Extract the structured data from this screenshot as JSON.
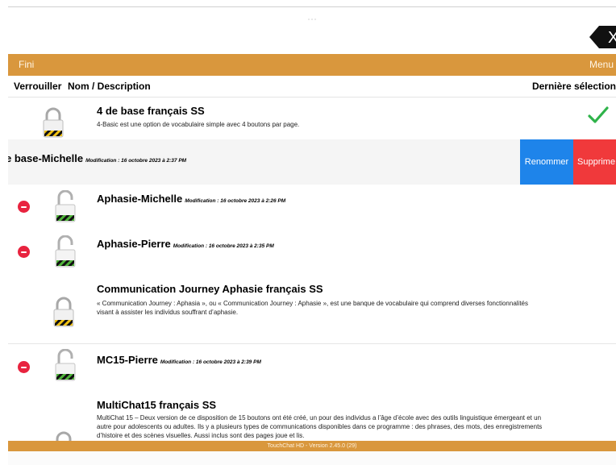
{
  "toolbar": {
    "left_label": "Fini",
    "right_label": "Menu"
  },
  "header": {
    "lock": "Verrouiller",
    "name": "Nom / Description",
    "last": "Dernière sélection"
  },
  "close_label": "X",
  "rows": [
    {
      "title": "4 de base français SS",
      "description": "4-Basic est une option de vocabulaire simple avec 4 boutons par page.",
      "locked": true,
      "selected": true
    },
    {
      "title": "e base-Michelle",
      "modified": "Modification : 16 octobre 2023 à 2:37 PM",
      "actions": {
        "rename": "Renommer",
        "delete": "Supprime"
      }
    },
    {
      "title": "Aphasie-Michelle",
      "modified": "Modification : 16 octobre 2023 à 2:26 PM",
      "deletable": true
    },
    {
      "title": "Aphasie-Pierre",
      "modified": "Modification : 16 octobre 2023 à 2:35 PM",
      "deletable": true
    },
    {
      "title": "Communication Journey Aphasie français SS",
      "description": "« Communication Journey : Aphasia », ou « Communication Journey : Aphasie », est une banque de vocabulaire qui comprend diverses fonctionnalités visant à assister les individus souffrant d’aphasie.",
      "locked": true
    },
    {
      "title": "MC15-Pierre",
      "modified": "Modification : 16 octobre 2023 à 2:39 PM",
      "deletable": true
    },
    {
      "title": "MultiChat15 français SS",
      "description": "MultiChat 15 – Deux version de ce disposition de 15 boutons ont été créé, un pour des individus a l’âge d’école avec des outils linguistique émergeant et un autre pour adolescents ou adultes. Ils y a plusieurs types de communications disponibles dans ce programme : des phrases, des mots, des enregistrements d’histoire et des scènes visuelles. Aussi inclus sont des pages joue et lis.",
      "locked": true
    }
  ],
  "footer": "TouchChat HD - Version 2.45.0 (29)",
  "colors": {
    "accent": "#d9973d",
    "rename": "#1e84ea",
    "delete": "#f0393b",
    "minus": "#e8233f",
    "check": "#2fb34a"
  },
  "icons": [
    "close-icon",
    "padlock-icon",
    "checkmark-icon",
    "minus-circle-icon"
  ]
}
